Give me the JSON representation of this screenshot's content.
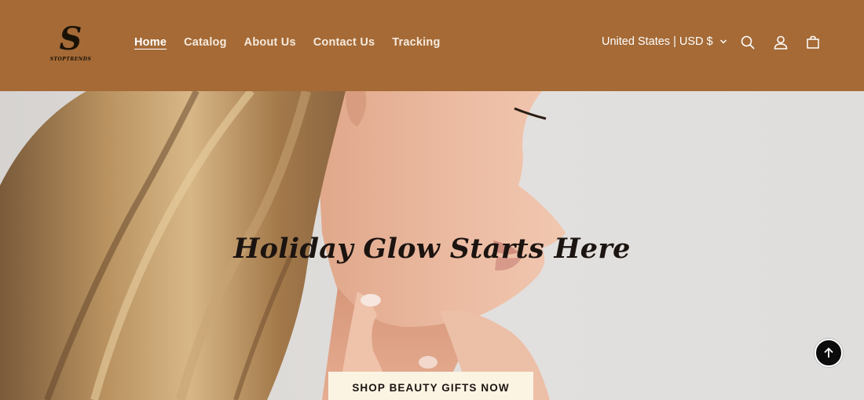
{
  "brand": {
    "logo_letter": "S",
    "logo_text": "STOPTRENDS"
  },
  "nav": {
    "items": [
      {
        "label": "Home",
        "active": true
      },
      {
        "label": "Catalog"
      },
      {
        "label": "About Us"
      },
      {
        "label": "Contact Us"
      },
      {
        "label": "Tracking"
      }
    ]
  },
  "header": {
    "locale_label": "United States | USD $",
    "icons": [
      "chevron-down-icon",
      "search-icon",
      "account-icon",
      "cart-icon"
    ],
    "background_color": "#a56a36"
  },
  "hero": {
    "title": "Holiday Glow Starts Here",
    "cta_label": "SHOP BEAUTY GIFTS NOW",
    "cta_color": "#fbf4e3",
    "image_description_icon": "woman-profile-photo"
  },
  "scroll_top": {
    "icon": "arrow-up-icon"
  }
}
